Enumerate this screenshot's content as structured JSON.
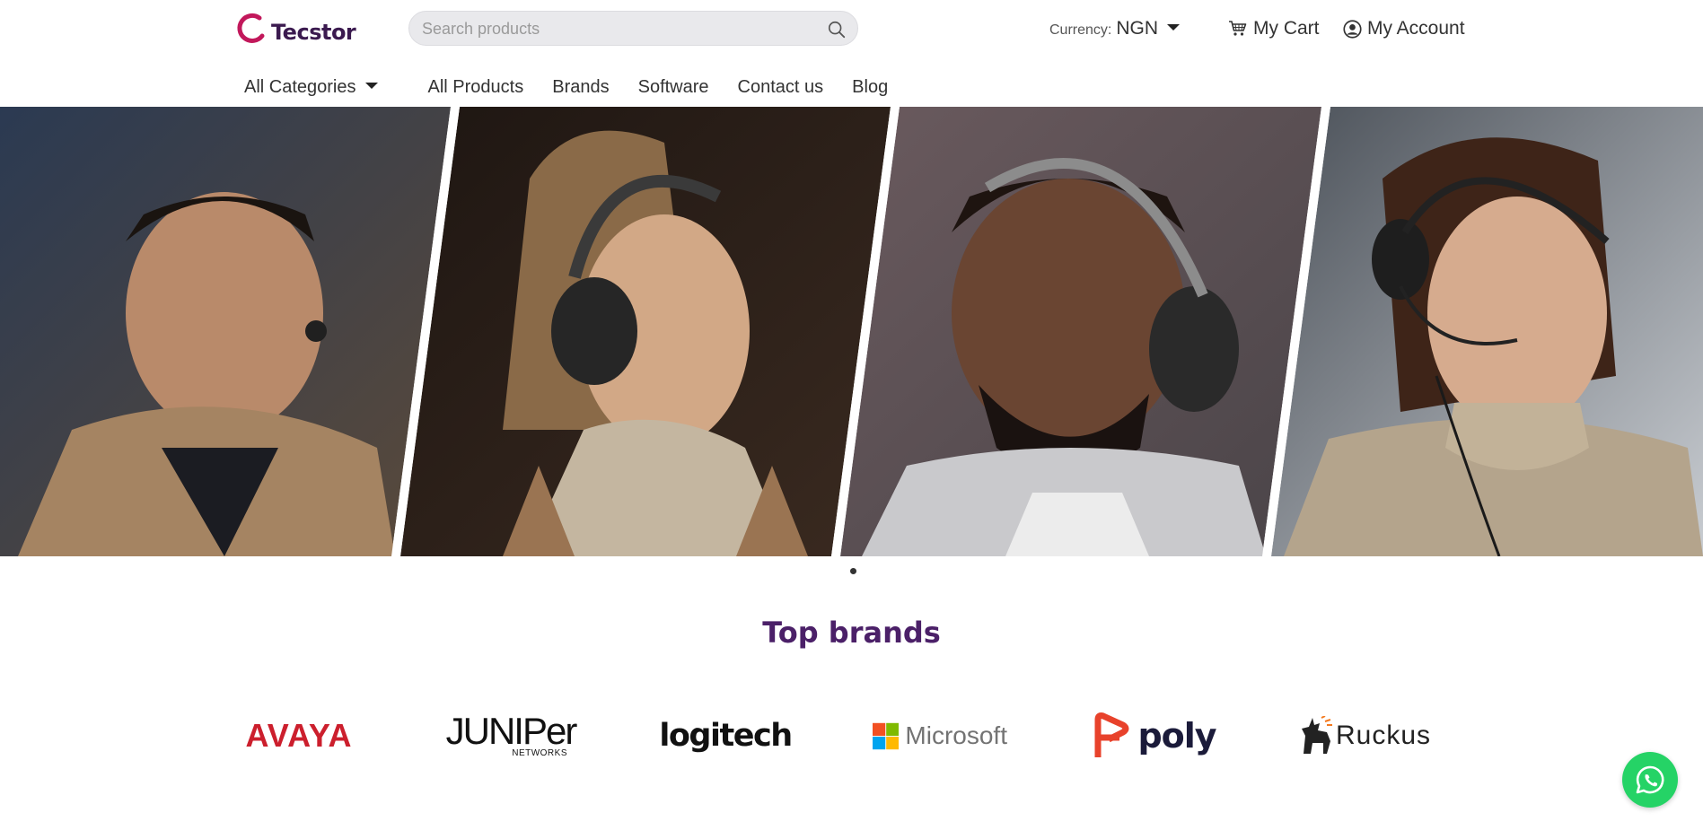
{
  "brand": {
    "name": "Tecstor",
    "accent": "#c2185b",
    "text_color": "#3b1a4f"
  },
  "search": {
    "placeholder": "Search products",
    "icon": "search-icon"
  },
  "currency": {
    "label": "Currency:",
    "value": "NGN"
  },
  "cart": {
    "label": "My Cart",
    "icon": "cart-icon"
  },
  "account": {
    "label": "My Account",
    "icon": "user-circle-icon"
  },
  "nav": {
    "categories_label": "All Categories",
    "items": [
      {
        "label": "All Products"
      },
      {
        "label": "Brands"
      },
      {
        "label": "Software"
      },
      {
        "label": "Contact us"
      },
      {
        "label": "Blog"
      }
    ]
  },
  "hero": {
    "panels": [
      "person-earbuds",
      "person-over-ear-headphones",
      "person-headphones-hoodie",
      "person-headset-mic"
    ],
    "active_slide": 1,
    "slide_count": 1
  },
  "top_brands": {
    "title": "Top brands",
    "brands": [
      {
        "name": "AVAYA",
        "color": "#cc1f2d"
      },
      {
        "name": "JUNIPer",
        "sub": "NETWORKS",
        "color": "#111111"
      },
      {
        "name": "logitech",
        "color": "#111111"
      },
      {
        "name": "Microsoft",
        "color": "#737373"
      },
      {
        "name": "poly",
        "color": "#1b1b3a",
        "accent": "#e8422b"
      },
      {
        "name": "Ruckus",
        "color": "#222222",
        "accent": "#f47a20"
      }
    ]
  },
  "whatsapp": {
    "icon": "whatsapp-icon",
    "color": "#25d366"
  }
}
